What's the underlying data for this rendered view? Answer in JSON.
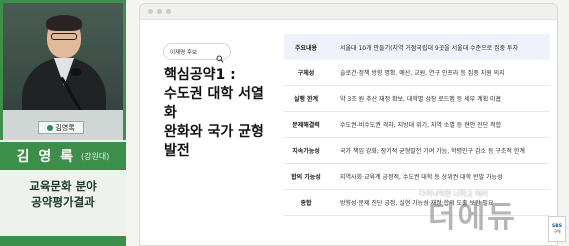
{
  "speaker": {
    "nameplate": "김영록",
    "name": "김 영 록",
    "affiliation": "(강원대)",
    "caption_line1": "교육문화 분야",
    "caption_line2": "공약평가결과"
  },
  "slide": {
    "search_label": "이재명 후보",
    "title_line1": "핵심공약1 :",
    "title_line2": "수도권 대학 서열화",
    "title_line3": "완화와 국가 균형발전",
    "rows": [
      {
        "key": "주요내용",
        "value": "서울대 10개 만들기(지역 거점국립대 9곳을 서울대 수준으로 집중 투자"
      },
      {
        "key": "구체성",
        "value": "슬로건·정책 방향 명확. 예산, 교원, 연구 인프라 등 집중 지원 의지"
      },
      {
        "key": "실행 한계",
        "value": "약 3조 원 추산 재정 확보, 대학별 성장 로드맵 등 세부 계획 미흡"
      },
      {
        "key": "문제해결력",
        "value": "수도권-비수도권 격차, 지방대 위기, 지역 소멸 등 현안 진단 적합"
      },
      {
        "key": "지속가능성",
        "value": "국가 책임 강화, 장기적 균형발전 기여 가능, 학령인구 감소 등 구조적 한계"
      },
      {
        "key": "합의 가능성",
        "value": "지역사회·교육계 긍정적, 수도권 대학 등 상위권 대학 반발 가능성"
      },
      {
        "key": "종합",
        "value": "방향성·문제 진단 긍정, 실현 가능성·재정·합의 도출 보완 필요"
      }
    ]
  },
  "overlay": {
    "subcaption": "다이나믹한 너하고 여러",
    "watermark": "더에듀",
    "corner_logo_top": "SBS",
    "corner_logo_bottom": "구역"
  },
  "colors": {
    "accent_green": "#3b8f4a",
    "highlight_row": "#eef3fb"
  }
}
